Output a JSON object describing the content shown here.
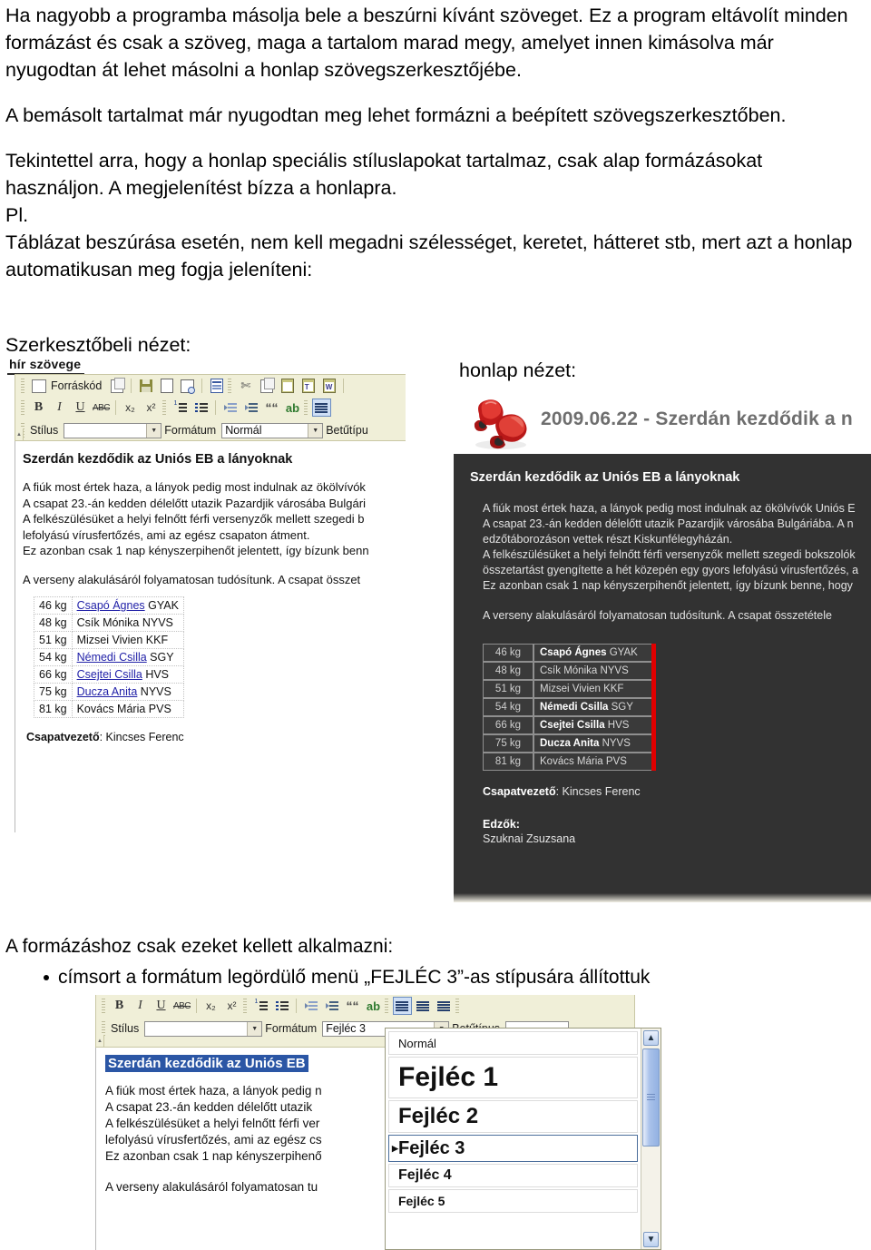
{
  "prose": {
    "para1": "Ha nagyobb a programba másolja bele a beszúrni kívánt szöveget. Ez a program eltávolít minden formázást és csak a szöveg, maga a tartalom marad megy, amelyet innen kimásolva már nyugodtan át lehet másolni a honlap szövegszerkesztőjébe.",
    "para2": "A bemásolt tartalmat már nyugodtan meg lehet formázni a beépített szövegszerkesztőben.",
    "para3": "Tekintettel arra, hogy a honlap speciális stíluslapokat tartalmaz, csak alap formázásokat használjon. A megjelenítést bízza a honlapra.",
    "para4": "Pl.",
    "para5": "Táblázat beszúrása esetén, nem kell megadni szélességet, keretet, hátteret stb, mert azt a honlap automatikusan meg fogja jeleníteni:"
  },
  "captions": {
    "editor": "Szerkesztőbeli nézet:",
    "site": "honlap nézet:"
  },
  "editor_shot": {
    "tab_label": "hír szövege",
    "toolbar": {
      "source_label": "Forráskód",
      "style_label": "Stílus",
      "style_value": "",
      "format_label": "Formátum",
      "format_value": "Normál",
      "font_label": "Betűtípu",
      "bold": "B",
      "italic": "I",
      "underline": "U",
      "strike": "ABC",
      "subscript": "x₂",
      "superscript": "x²",
      "quote": "““",
      "spell": "ab",
      "arrow": "▼"
    },
    "heading": "Szerdán kezdődik az Uniós EB a lányoknak",
    "paragraphs": [
      "A fiúk most értek haza, a lányok pedig most indulnak az ökölvívók",
      "A csapat 23.-án kedden délelőtt utazik Pazardjik városába Bulgári",
      "A felkészülésüket a helyi felnőtt férfi versenyzők mellett szegedi b",
      "lefolyású vírusfertőzés, ami az egész csapaton átment.",
      "Ez azonban csak 1 nap kényszerpihenőt jelentett, így bízunk benn"
    ],
    "paragraph2": "A verseny alakulásáról folyamatosan tudósítunk. A csapat összet",
    "table": [
      {
        "kg": "46 kg",
        "name": "Csapó Ágnes",
        "club": "GYAK",
        "link": true
      },
      {
        "kg": "48 kg",
        "name": "Csík Mónika",
        "club": "NYVS",
        "link": false
      },
      {
        "kg": "51 kg",
        "name": "Mizsei Vivien",
        "club": "KKF",
        "link": false
      },
      {
        "kg": "54 kg",
        "name": "Némedi Csilla",
        "club": "SGY",
        "link": true
      },
      {
        "kg": "66 kg",
        "name": "Csejtei Csilla",
        "club": "HVS",
        "link": true
      },
      {
        "kg": "75 kg",
        "name": "Ducza Anita",
        "club": "NYVS",
        "link": true
      },
      {
        "kg": "81 kg",
        "name": "Kovács Mária",
        "club": "PVS",
        "link": false
      }
    ],
    "leader_label": "Csapatvezető",
    "leader_name": ": Kincses Ferenc"
  },
  "site_shot": {
    "title": "2009.06.22 - Szerdán kezdődik a n",
    "heading": "Szerdán kezdődik az Uniós EB a lányoknak",
    "paragraphs": [
      "A fiúk most értek haza, a lányok pedig most indulnak az ökölvívók Uniós E",
      "A csapat 23.-án kedden délelőtt utazik Pazardjik városába Bulgáriába. A n",
      "edzőtáborozáson vettek részt Kiskunfélegyházán.",
      "A felkészülésüket a helyi felnőtt férfi versenyzők mellett szegedi bokszolók",
      "összetartást gyengítette a hét közepén egy gyors lefolyású vírusfertőzés, a",
      "Ez azonban csak 1 nap kényszerpihenőt jelentett, így bízunk benne, hogy"
    ],
    "paragraph2": "A verseny alakulásáról folyamatosan tudósítunk. A csapat összetétele",
    "table": [
      {
        "kg": "46 kg",
        "name": "Csapó Ágnes",
        "club": "GYAK",
        "bold": true
      },
      {
        "kg": "48 kg",
        "name": "Csík Mónika",
        "club": "NYVS",
        "bold": false
      },
      {
        "kg": "51 kg",
        "name": "Mizsei Vivien",
        "club": "KKF",
        "bold": false
      },
      {
        "kg": "54 kg",
        "name": "Némedi Csilla",
        "club": "SGY",
        "bold": true
      },
      {
        "kg": "66 kg",
        "name": "Csejtei Csilla",
        "club": "HVS",
        "bold": true
      },
      {
        "kg": "75 kg",
        "name": "Ducza Anita",
        "club": "NYVS",
        "bold": true
      },
      {
        "kg": "81 kg",
        "name": "Kovács Mária",
        "club": "PVS",
        "bold": false
      }
    ],
    "leader_label": "Csapatvezető",
    "leader_name": ": Kincses Ferenc",
    "coach_label": "Edzők:",
    "coach_name": "Szuknai Zsuzsana",
    "accent_color": "#e00000",
    "bg_color": "#323232"
  },
  "bottom": {
    "intro": "A formázáshoz csak ezeket kellett alkalmazni:",
    "bullet": "címsort a formátum legördülő menü „FEJLÉC 3”-as stípusára állítottuk"
  },
  "bottom_shot": {
    "toolbar": {
      "style_label": "Stílus",
      "style_value": "",
      "format_label": "Formátum",
      "format_value": "Fejléc 3",
      "font_label": "Betűtípus",
      "arrow": "▼"
    },
    "heading": "Szerdán kezdődik az Uniós EB",
    "paragraphs": [
      "A fiúk most értek haza, a lányok pedig n",
      "A csapat 23.-án kedden délelőtt utazik",
      "A felkészülésüket a helyi felnőtt férfi ver",
      "lefolyású vírusfertőzés, ami az egész cs",
      "Ez azonban csak 1 nap kényszerpihenő"
    ],
    "paragraph2": "A verseny alakulásáról folyamatosan tu",
    "dropdown": {
      "items": [
        {
          "label": "Normál",
          "size": 13,
          "weight": "normal",
          "selected": false
        },
        {
          "label": "Fejléc 1",
          "size": 30,
          "weight": "bold",
          "selected": false
        },
        {
          "label": "Fejléc 2",
          "size": 24,
          "weight": "bold",
          "selected": false
        },
        {
          "label": "Fejléc 3",
          "size": 20,
          "weight": "bold",
          "selected": true
        },
        {
          "label": "Fejléc 4",
          "size": 16,
          "weight": "bold",
          "selected": false
        },
        {
          "label": "Fejléc 5",
          "size": 14,
          "weight": "bold",
          "selected": false
        }
      ],
      "up_arrow": "▲",
      "down_arrow": "▼",
      "selection_marker": "▶"
    }
  }
}
